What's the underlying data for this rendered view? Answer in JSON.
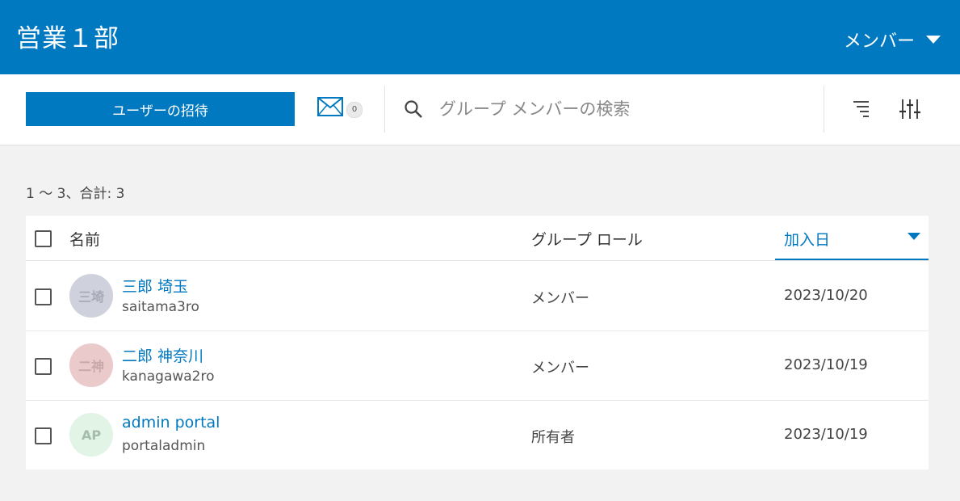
{
  "header": {
    "title": "営業１部",
    "menu_label": "メンバー"
  },
  "toolbar": {
    "invite_label": "ユーザーの招待",
    "mail_count": "0",
    "search_placeholder": "グループ メンバーの検索",
    "icons": [
      "mail-icon",
      "search-icon",
      "sort-icon",
      "filter-icon"
    ]
  },
  "results": {
    "count_text": "1 〜 3、合計: 3"
  },
  "table": {
    "columns": {
      "name": "名前",
      "role": "グループ ロール",
      "joined": "加入日"
    },
    "sorted_column": "joined",
    "sort_direction": "descending",
    "rows": [
      {
        "avatar": "三埼",
        "avatar_bg": "#cfd1dc",
        "avatar_fg": "#a9aab8",
        "name": "三郎 埼玉",
        "username": "saitama3ro",
        "role": "メンバー",
        "joined": "2023/10/20"
      },
      {
        "avatar": "二神",
        "avatar_bg": "#ebcacb",
        "avatar_fg": "#c8a8a9",
        "name": "二郎 神奈川",
        "username": "kanagawa2ro",
        "role": "メンバー",
        "joined": "2023/10/19"
      },
      {
        "avatar": "AP",
        "avatar_bg": "#e1f4e6",
        "avatar_fg": "#a6bcab",
        "name": "admin portal",
        "username": "portaladmin",
        "role": "所有者",
        "joined": "2023/10/19"
      }
    ]
  },
  "colors": {
    "brand": "#0079c1",
    "page_bg": "#f2f2f2"
  }
}
